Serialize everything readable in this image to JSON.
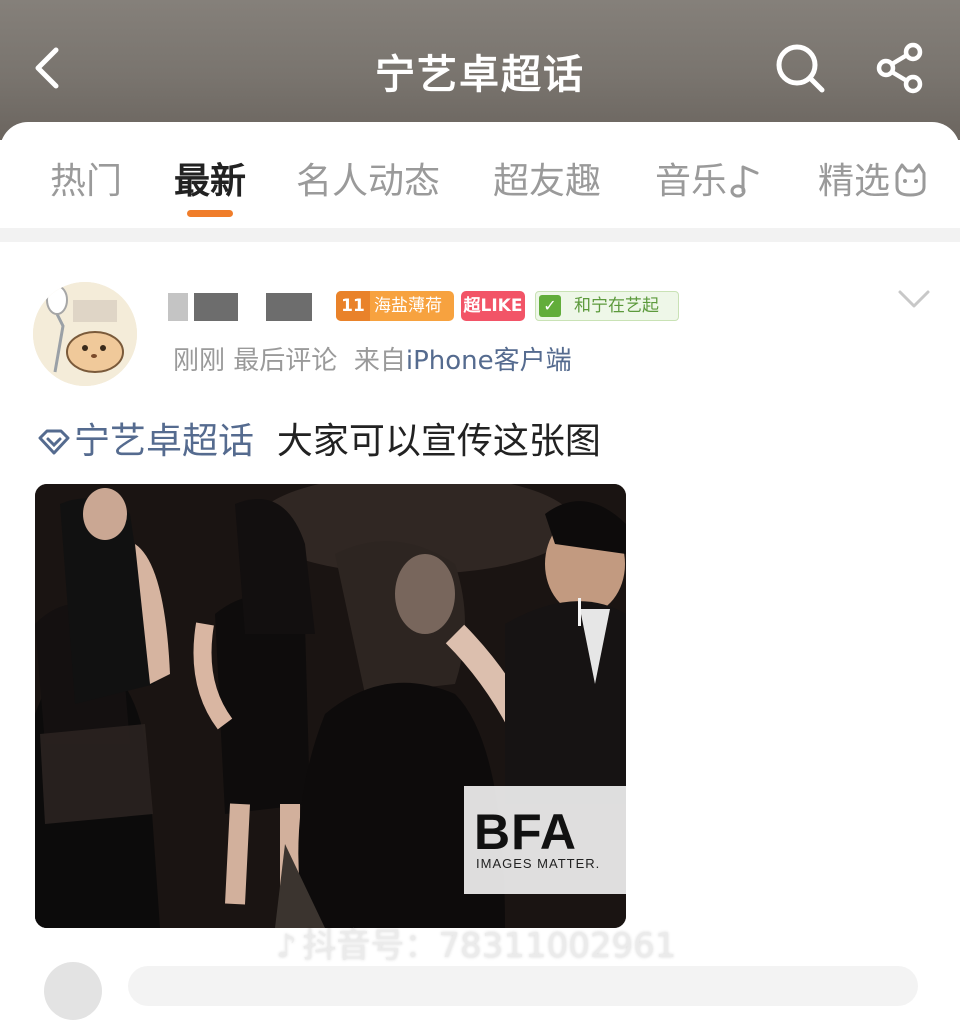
{
  "header": {
    "title": "宁艺卓超话",
    "back_icon": "back-arrow-icon",
    "search_icon": "search-icon",
    "share_icon": "share-icon",
    "background": "#7c7771"
  },
  "tabs": [
    {
      "label": "热门",
      "active": false
    },
    {
      "label": "最新",
      "active": true
    },
    {
      "label": "名人动态",
      "active": false
    },
    {
      "label": "超友趣",
      "active": false
    },
    {
      "label": "音乐",
      "active": false,
      "icon": "music-note-icon"
    },
    {
      "label": "精选",
      "active": false,
      "icon": "cat-icon"
    }
  ],
  "accent_color": "#f07d2a",
  "post": {
    "avatar_icon": "hamster-avatar",
    "badges": {
      "rank_level": "11",
      "rank_text": "海盐薄荷",
      "like": "超LIKE",
      "event_check": "✓",
      "event": "和宁在艺起"
    },
    "meta": {
      "time": "刚刚",
      "last_comment": "最后评论",
      "source": "来自",
      "device": "iPhone客户端"
    },
    "content": {
      "topic": "宁艺卓超话",
      "text": "大家可以宣传这张图"
    },
    "image": {
      "watermark_logo": "BFA",
      "watermark_sub": "IMAGES MATTER.",
      "overlay_icon": "♪",
      "overlay": "抖音号：78311002961"
    }
  }
}
